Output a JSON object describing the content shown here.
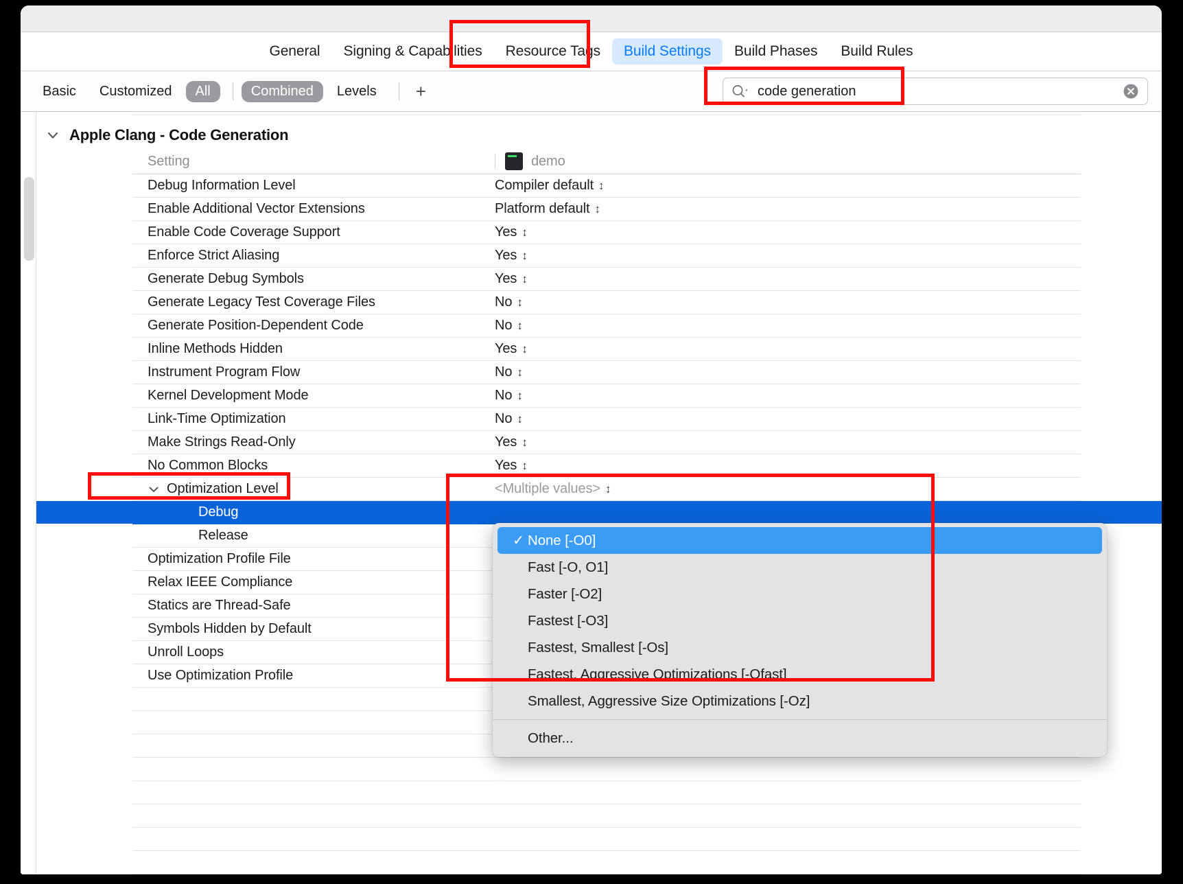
{
  "window": {
    "title": ""
  },
  "tabs": [
    {
      "label": "General",
      "active": false
    },
    {
      "label": "Signing & Capabilities",
      "active": false
    },
    {
      "label": "Resource Tags",
      "active": false
    },
    {
      "label": "Build Settings",
      "active": true
    },
    {
      "label": "Build Phases",
      "active": false
    },
    {
      "label": "Build Rules",
      "active": false
    }
  ],
  "filterbar": {
    "items": [
      {
        "label": "Basic",
        "selected": false
      },
      {
        "label": "Customized",
        "selected": false
      },
      {
        "label": "All",
        "selected": true
      }
    ],
    "items2": [
      {
        "label": "Combined",
        "selected": true
      },
      {
        "label": "Levels",
        "selected": false
      }
    ],
    "add_label": "+"
  },
  "search": {
    "value": "code generation",
    "placeholder": "",
    "icon": "search-icon",
    "clear_icon": "clear-circle-icon"
  },
  "group": {
    "title": "Apple Clang - Code Generation",
    "expanded": true
  },
  "columns": {
    "setting": "Setting",
    "target": "demo",
    "target_icon": "app-target-icon"
  },
  "rows": [
    {
      "name": "Debug Information Level",
      "value": "Compiler default",
      "stepper": true
    },
    {
      "name": "Enable Additional Vector Extensions",
      "value": "Platform default",
      "stepper": true
    },
    {
      "name": "Enable Code Coverage Support",
      "value": "Yes",
      "stepper": true
    },
    {
      "name": "Enforce Strict Aliasing",
      "value": "Yes",
      "stepper": true
    },
    {
      "name": "Generate Debug Symbols",
      "value": "Yes",
      "stepper": true
    },
    {
      "name": "Generate Legacy Test Coverage Files",
      "value": "No",
      "stepper": true
    },
    {
      "name": "Generate Position-Dependent Code",
      "value": "No",
      "stepper": true
    },
    {
      "name": "Inline Methods Hidden",
      "value": "Yes",
      "stepper": true
    },
    {
      "name": "Instrument Program Flow",
      "value": "No",
      "stepper": true
    },
    {
      "name": "Kernel Development Mode",
      "value": "No",
      "stepper": true
    },
    {
      "name": "Link-Time Optimization",
      "value": "No",
      "stepper": true
    },
    {
      "name": "Make Strings Read-Only",
      "value": "Yes",
      "stepper": true
    },
    {
      "name": "No Common Blocks",
      "value": "Yes",
      "stepper": true
    },
    {
      "name": "Optimization Level",
      "value": "<Multiple values>",
      "stepper": true,
      "expandable": true,
      "expanded": true,
      "muted": true
    },
    {
      "name": "Debug",
      "value": "",
      "sub": true,
      "selected": true
    },
    {
      "name": "Release",
      "value": "",
      "sub": true
    },
    {
      "name": "Optimization Profile File",
      "value": ""
    },
    {
      "name": "Relax IEEE Compliance",
      "value": ""
    },
    {
      "name": "Statics are Thread-Safe",
      "value": ""
    },
    {
      "name": "Symbols Hidden by Default",
      "value": ""
    },
    {
      "name": "Unroll Loops",
      "value": ""
    },
    {
      "name": "Use Optimization Profile",
      "value": ""
    },
    {
      "name": "",
      "value": ""
    },
    {
      "name": "",
      "value": ""
    },
    {
      "name": "",
      "value": ""
    },
    {
      "name": "",
      "value": ""
    },
    {
      "name": "",
      "value": ""
    },
    {
      "name": "",
      "value": ""
    }
  ],
  "menu": {
    "items": [
      {
        "label": "None [-O0]",
        "checked": true,
        "selected": true
      },
      {
        "label": "Fast [-O, O1]",
        "checked": false,
        "selected": false
      },
      {
        "label": "Faster [-O2]",
        "checked": false,
        "selected": false
      },
      {
        "label": "Fastest [-O3]",
        "checked": false,
        "selected": false
      },
      {
        "label": "Fastest, Smallest [-Os]",
        "checked": false,
        "selected": false
      },
      {
        "label": "Fastest, Aggressive Optimizations [-Ofast]",
        "checked": false,
        "selected": false
      },
      {
        "label": "Smallest, Aggressive Size Optimizations [-Oz]",
        "checked": false,
        "selected": false
      }
    ],
    "other_label": "Other...",
    "check_glyph": "✓"
  },
  "colors": {
    "accent": "#0a7cff",
    "selection": "#0a63d8",
    "menu_selection": "#3b9cf5",
    "annotation": "#fb0d08",
    "tab_active_bg": "#d6e9ff",
    "segment_on": "#9a9aa0"
  },
  "annotations": [
    {
      "name": "build-settings-tab-highlight"
    },
    {
      "name": "search-field-highlight"
    },
    {
      "name": "optimization-level-highlight"
    },
    {
      "name": "optimization-options-highlight"
    }
  ]
}
